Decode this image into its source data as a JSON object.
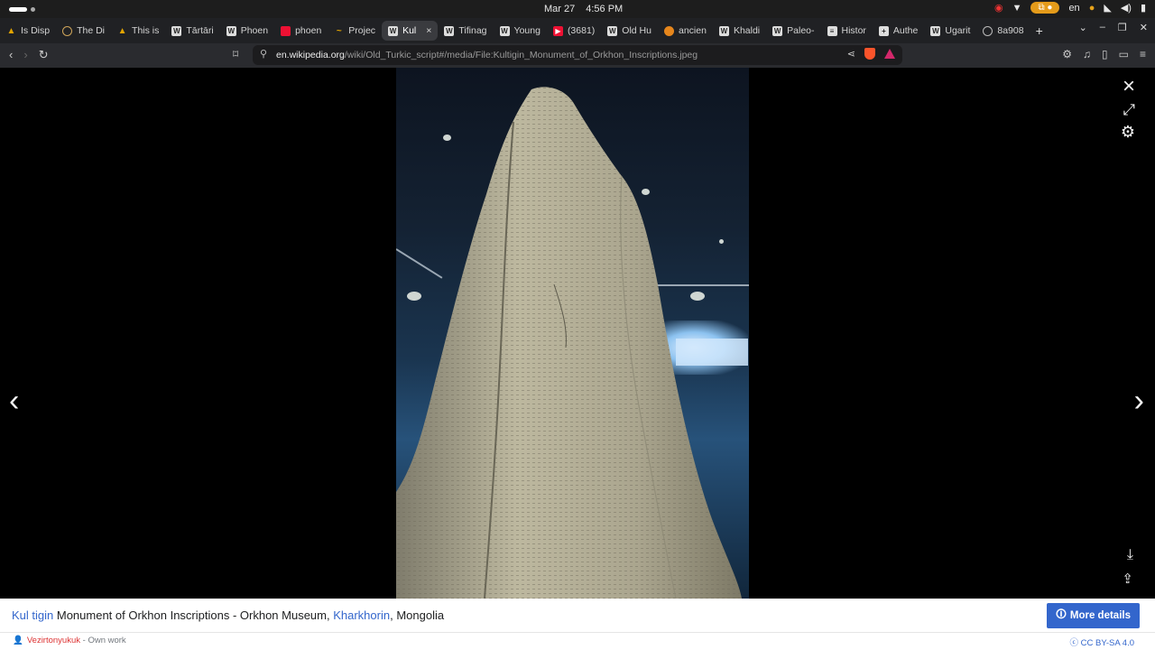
{
  "system": {
    "date": "Mar 27",
    "time": "4:56 PM",
    "language": "en"
  },
  "tabs": [
    {
      "label": "Is Disp",
      "icon": "triangle-icon"
    },
    {
      "label": "The Di",
      "icon": "ring-icon"
    },
    {
      "label": "This is",
      "icon": "triangle-icon"
    },
    {
      "label": "Tārtāri",
      "icon": "wikipedia-icon"
    },
    {
      "label": "Phoen",
      "icon": "wikipedia-icon"
    },
    {
      "label": "phoen",
      "icon": "search-icon"
    },
    {
      "label": "Projec",
      "icon": "project-icon"
    },
    {
      "label": "Kul",
      "icon": "wikipedia-icon",
      "active": true
    },
    {
      "label": "Tifinag",
      "icon": "wikipedia-icon"
    },
    {
      "label": "Young",
      "icon": "wikipedia-icon"
    },
    {
      "label": "(3681)",
      "icon": "youtube-icon"
    },
    {
      "label": "Old Hu",
      "icon": "wikipedia-icon"
    },
    {
      "label": "ancien",
      "icon": "orange-circle-icon"
    },
    {
      "label": "Khaldi",
      "icon": "wikipedia-icon"
    },
    {
      "label": "Paleo-",
      "icon": "wikipedia-icon"
    },
    {
      "label": "Histor",
      "icon": "flag-icon"
    },
    {
      "label": "Authe",
      "icon": "plus-icon"
    },
    {
      "label": "Ugarit",
      "icon": "wikipedia-icon"
    },
    {
      "label": "8a908",
      "icon": "globe-icon"
    }
  ],
  "address_bar": {
    "host": "en.wikipedia.org",
    "path": "/wiki/Old_Turkic_script#/media/File:Kultigin_Monument_of_Orkhon_Inscriptions.jpeg"
  },
  "caption": {
    "link1": "Kul tigin",
    "text1": " Monument of Orkhon Inscriptions - Orkhon Museum, ",
    "link2": "Kharkhorin",
    "text2": ", Mongolia"
  },
  "more_details_label": "More details",
  "credits": {
    "author": "Vezirtonyukuk",
    "source": " - Own work",
    "license": "CC BY-SA 4.0"
  }
}
